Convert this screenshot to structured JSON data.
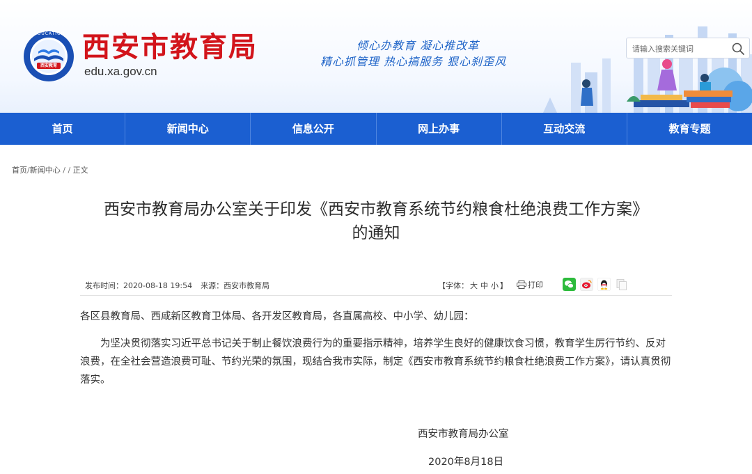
{
  "header": {
    "site_name": "西安市教育局",
    "domain": "edu.xa.gov.cn",
    "logo_text": "西安教育",
    "logo_arc_text": "EDUCATION",
    "slogan_line1": "倾心办教育  凝心推改革",
    "slogan_line2": "精心抓管理  热心搞服务  狠心刹歪风",
    "search": {
      "placeholder": "请输入搜索关键词",
      "icon": "search-icon"
    },
    "colors": {
      "brand_red": "#d2141b",
      "slogan_blue": "#1f64c8"
    }
  },
  "nav": {
    "items": [
      {
        "label": "首页"
      },
      {
        "label": "新闻中心"
      },
      {
        "label": "信息公开"
      },
      {
        "label": "网上办事"
      },
      {
        "label": "互动交流"
      },
      {
        "label": "教育专题"
      }
    ],
    "color": "#1b5fd1"
  },
  "breadcrumb": {
    "home": "首页",
    "section": "新闻中心",
    "separator": "/",
    "current": "正文"
  },
  "article": {
    "title_line1": "西安市教育局办公室关于印发《西安市教育系统节约粮食杜绝浪费工作方案》",
    "title_line2": "的通知",
    "meta": {
      "published_label": "发布时间：",
      "published": "2020-08-18 19:54",
      "source_label": "来源：",
      "source": "西安市教育局"
    },
    "font_size": {
      "prefix": "【字体：",
      "large": "大",
      "medium": "中",
      "small": "小",
      "suffix": "】"
    },
    "print_label": "打印",
    "share_icons": [
      "wechat-icon",
      "weibo-icon",
      "qq-icon",
      "copy-icon"
    ],
    "salutation": "各区县教育局、西咸新区教育卫体局、各开发区教育局，各直属高校、中小学、幼儿园：",
    "body": "为坚决贯彻落实习近平总书记关于制止餐饮浪费行为的重要指示精神，培养学生良好的健康饮食习惯，教育学生厉行节约、反对浪费，在全社会营造浪费可耻、节约光荣的氛围，现结合我市实际，制定《西安市教育系统节约粮食杜绝浪费工作方案》，请认真贯彻落实。",
    "signature_org": "西安市教育局办公室",
    "signature_date": "2020年8月18日"
  }
}
